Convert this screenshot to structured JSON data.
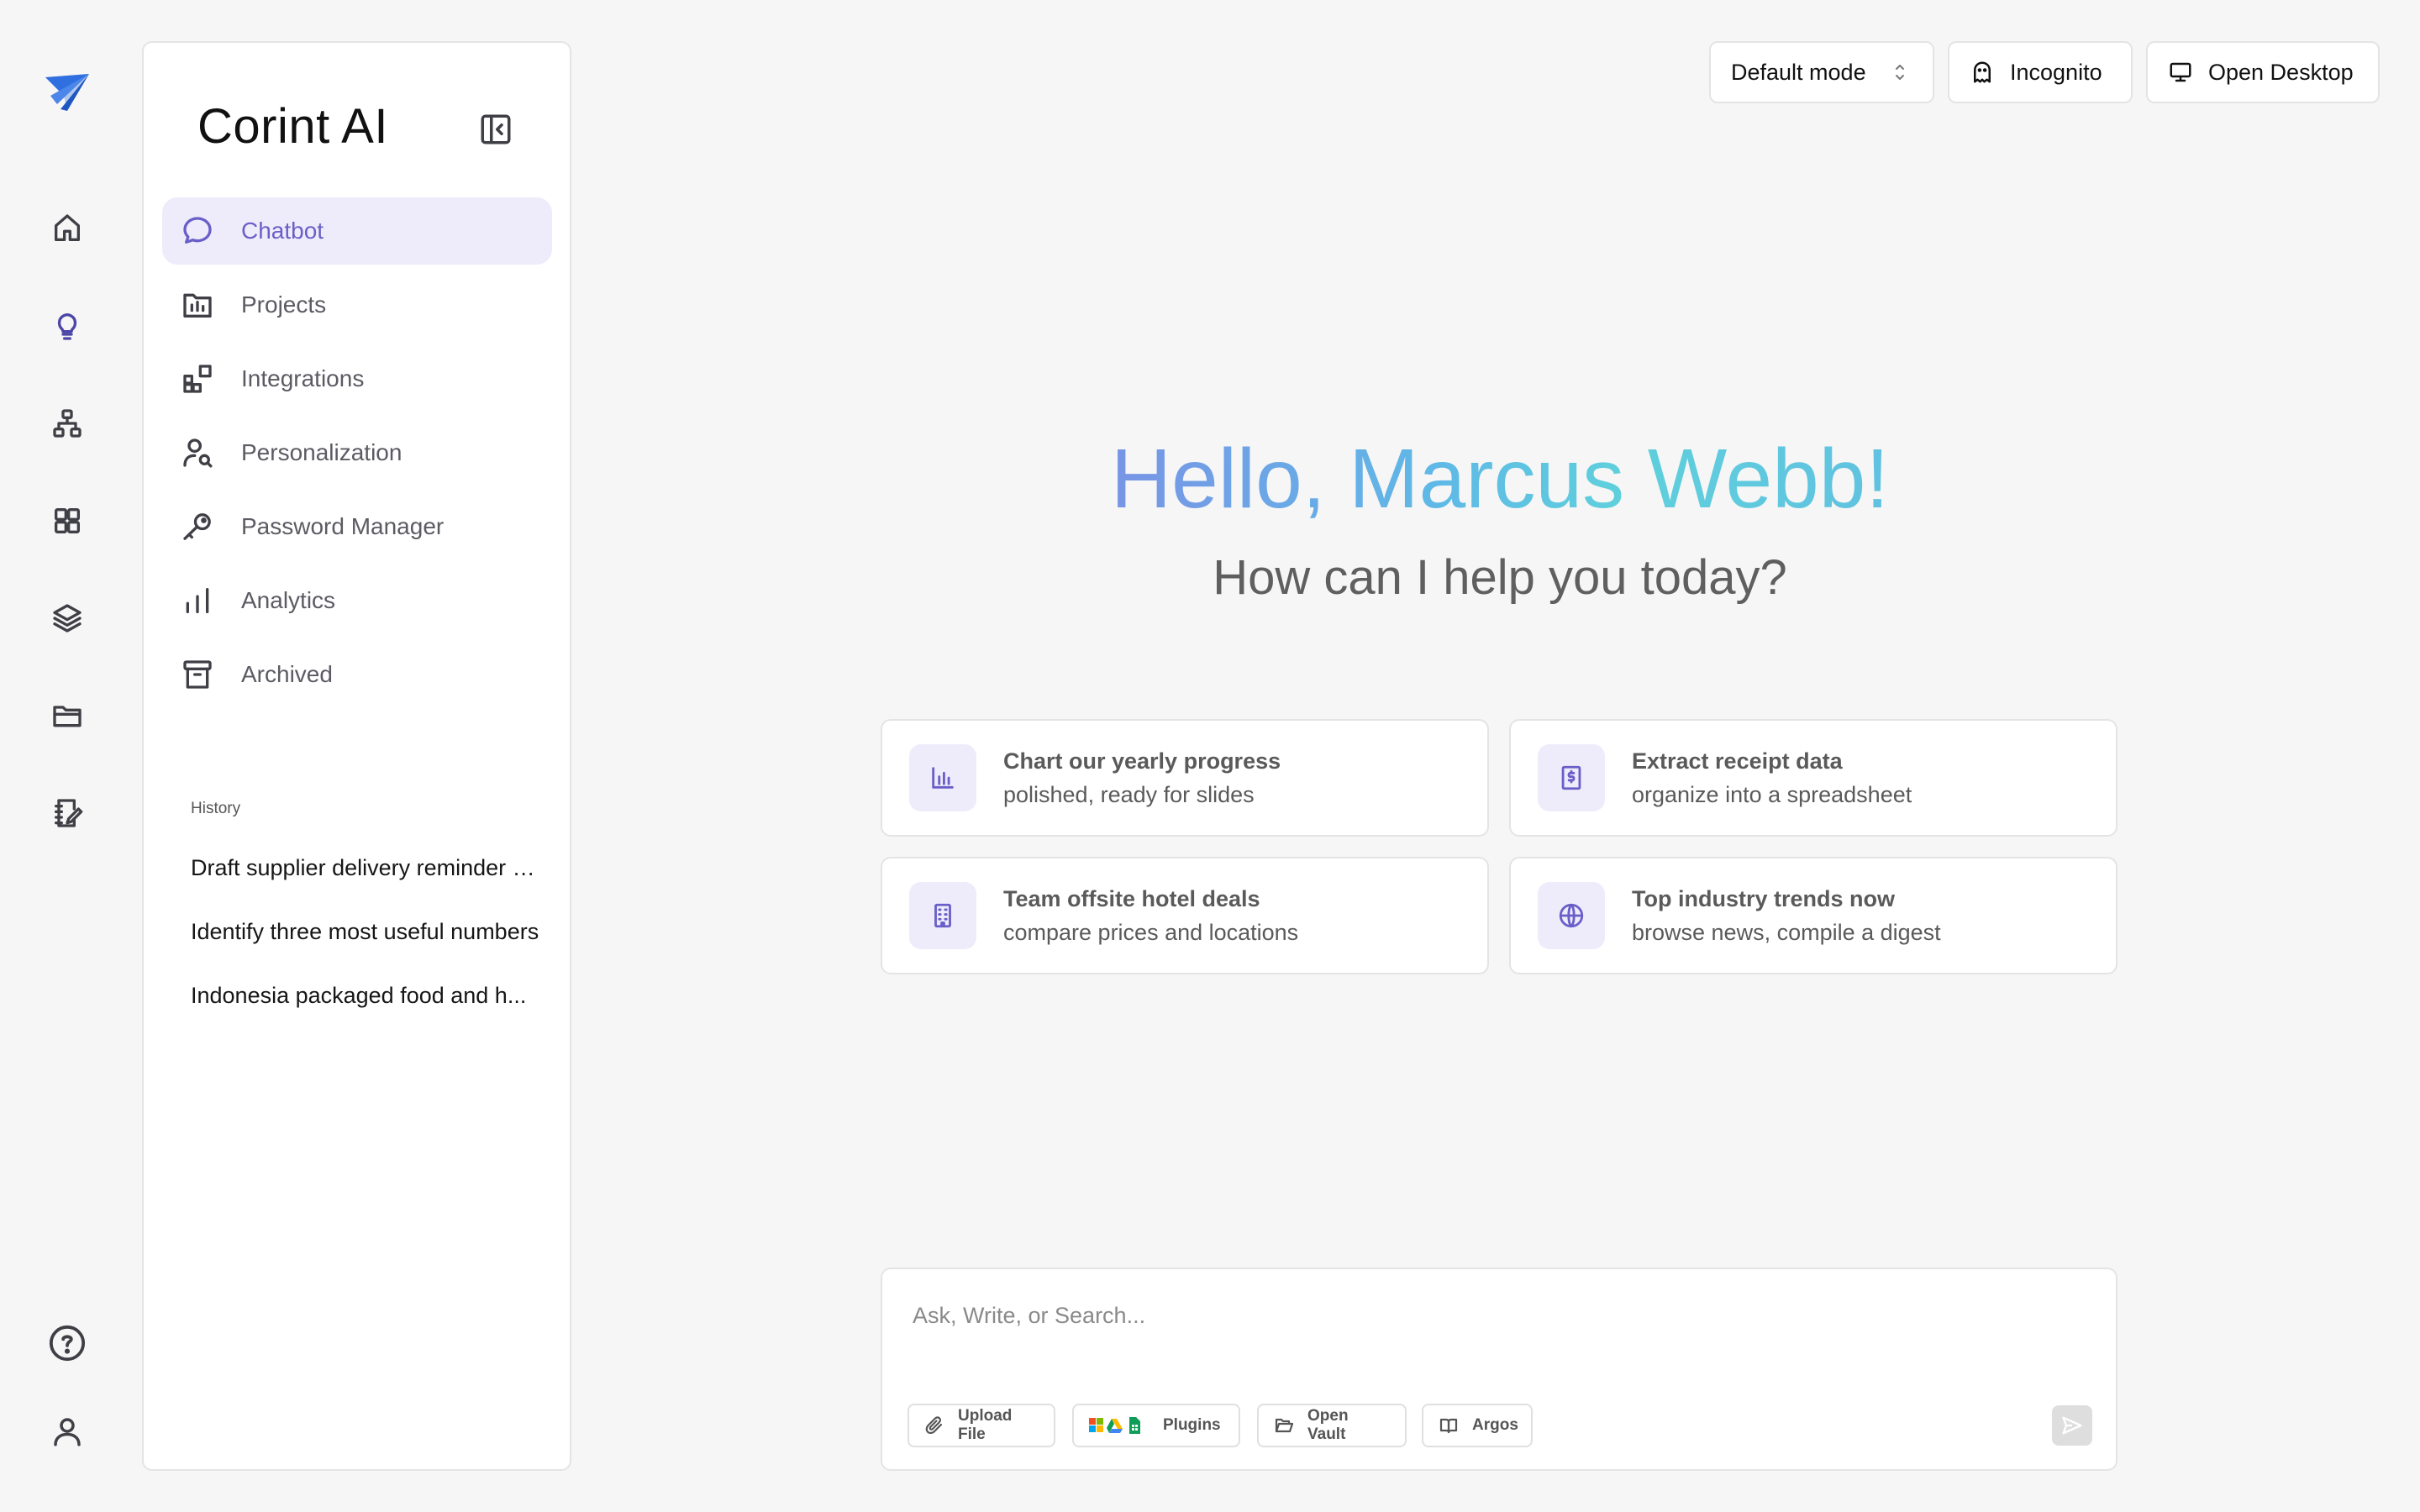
{
  "rail": {
    "items": [
      {
        "name": "home",
        "icon": "home-icon"
      },
      {
        "name": "ideas",
        "icon": "lightbulb-icon"
      },
      {
        "name": "workflows",
        "icon": "hierarchy-icon"
      },
      {
        "name": "apps",
        "icon": "grid-icon"
      },
      {
        "name": "layers",
        "icon": "layers-icon"
      },
      {
        "name": "files",
        "icon": "folder-icon"
      },
      {
        "name": "notes",
        "icon": "notebook-edit-icon"
      }
    ],
    "bottom": [
      {
        "name": "help",
        "icon": "help-circle-icon"
      },
      {
        "name": "profile",
        "icon": "user-icon"
      }
    ]
  },
  "sidebar": {
    "title": "Corint AI",
    "nav": [
      {
        "label": "Chatbot",
        "icon": "chat-bubble-icon",
        "active": true
      },
      {
        "label": "Projects",
        "icon": "folder-chart-icon"
      },
      {
        "label": "Integrations",
        "icon": "integrations-icon"
      },
      {
        "label": "Personalization",
        "icon": "user-search-icon"
      },
      {
        "label": "Password Manager",
        "icon": "key-icon"
      },
      {
        "label": "Analytics",
        "icon": "bar-chart-icon"
      },
      {
        "label": "Archived",
        "icon": "archive-icon"
      }
    ],
    "history_label": "History",
    "history": [
      "Draft supplier delivery reminder email",
      "Identify three most useful numbers",
      "Indonesia packaged food and h..."
    ]
  },
  "topbar": {
    "mode_label": "Default mode",
    "incognito_label": "Incognito",
    "desktop_label": "Open Desktop"
  },
  "hero": {
    "greeting": "Hello, Marcus Webb!",
    "subtitle": "How can I help you today?"
  },
  "suggestions": [
    {
      "title": "Chart our yearly progress",
      "subtitle": "polished, ready for slides",
      "icon": "bar-chart-icon"
    },
    {
      "title": "Extract receipt data",
      "subtitle": "organize into a spreadsheet",
      "icon": "receipt-icon"
    },
    {
      "title": "Team offsite hotel deals",
      "subtitle": "compare prices and locations",
      "icon": "building-icon"
    },
    {
      "title": "Top industry trends now",
      "subtitle": "browse news, compile a digest",
      "icon": "globe-icon"
    }
  ],
  "composer": {
    "placeholder": "Ask, Write, or Search...",
    "upload_label": "Upload File",
    "plugins_label": "Plugins",
    "vault_label": "Open Vault",
    "argos_label": "Argos"
  },
  "colors": {
    "accent": "#6a5fc8",
    "accent_bg": "#eeecfb",
    "brand": "#2f6fe0"
  }
}
